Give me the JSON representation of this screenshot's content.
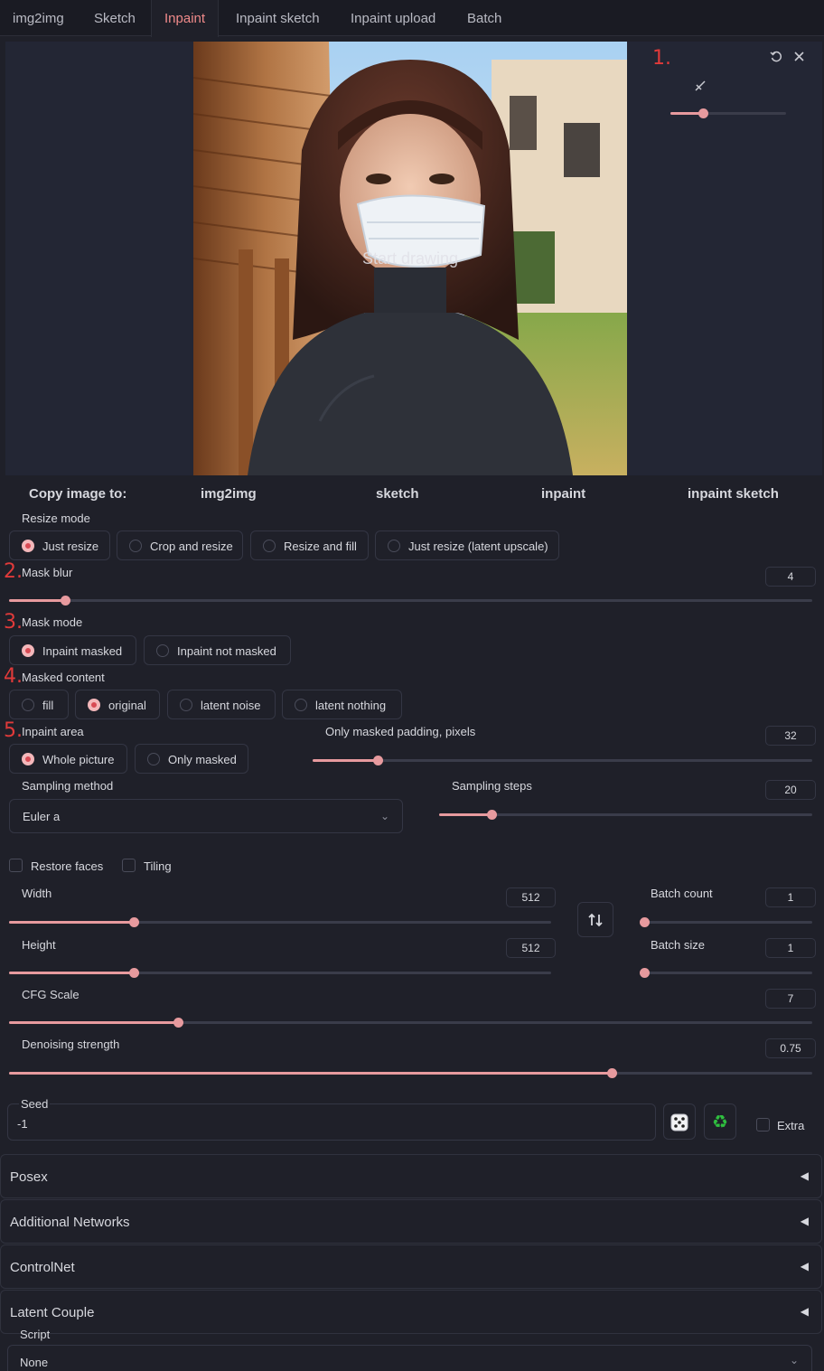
{
  "tabs": [
    {
      "label": "img2img"
    },
    {
      "label": "Sketch"
    },
    {
      "label": "Inpaint"
    },
    {
      "label": "Inpaint sketch"
    },
    {
      "label": "Inpaint upload"
    },
    {
      "label": "Batch"
    }
  ],
  "active_tab": "Inpaint",
  "canvas": {
    "overlay_text": "Start drawing",
    "brush_size_fraction": 0.28
  },
  "annotations": [
    "1.",
    "2.",
    "3.",
    "4.",
    "5."
  ],
  "copy_image": {
    "label": "Copy image to:",
    "targets": [
      "img2img",
      "sketch",
      "inpaint",
      "inpaint sketch"
    ]
  },
  "resize_mode": {
    "label": "Resize mode",
    "options": [
      "Just resize",
      "Crop and resize",
      "Resize and fill",
      "Just resize (latent upscale)"
    ],
    "selected": "Just resize"
  },
  "mask_blur": {
    "label": "Mask blur",
    "value": "4",
    "fraction": 0.07
  },
  "mask_mode": {
    "label": "Mask mode",
    "options": [
      "Inpaint masked",
      "Inpaint not masked"
    ],
    "selected": "Inpaint masked"
  },
  "masked_content": {
    "label": "Masked content",
    "options": [
      "fill",
      "original",
      "latent noise",
      "latent nothing"
    ],
    "selected": "original"
  },
  "inpaint_area": {
    "label": "Inpaint area",
    "options": [
      "Whole picture",
      "Only masked"
    ],
    "selected": "Whole picture"
  },
  "padding": {
    "label": "Only masked padding, pixels",
    "value": "32",
    "fraction": 0.13
  },
  "sampling_method": {
    "label": "Sampling method",
    "value": "Euler a"
  },
  "sampling_steps": {
    "label": "Sampling steps",
    "value": "20",
    "fraction": 0.14
  },
  "restore_faces": {
    "label": "Restore faces",
    "checked": false
  },
  "tiling": {
    "label": "Tiling",
    "checked": false
  },
  "width": {
    "label": "Width",
    "value": "512",
    "fraction": 0.23
  },
  "height": {
    "label": "Height",
    "value": "512",
    "fraction": 0.23
  },
  "batch_count": {
    "label": "Batch count",
    "value": "1",
    "fraction": 0.0
  },
  "batch_size": {
    "label": "Batch size",
    "value": "1",
    "fraction": 0.0
  },
  "cfg_scale": {
    "label": "CFG Scale",
    "value": "7",
    "fraction": 0.21
  },
  "denoising": {
    "label": "Denoising strength",
    "value": "0.75",
    "fraction": 0.75
  },
  "seed": {
    "label": "Seed",
    "value": "-1"
  },
  "extra": {
    "label": "Extra",
    "checked": false
  },
  "accordions": [
    "Posex",
    "Additional Networks",
    "ControlNet",
    "Latent Couple"
  ],
  "script": {
    "label": "Script",
    "value": "None"
  },
  "colors": {
    "accent": "#e79a9e",
    "active_tab": "#f08a8a",
    "background": "#1f2029",
    "annotation_red": "#e03a3a"
  },
  "icons": {
    "undo": "undo-icon",
    "close": "close-icon",
    "brush": "brush-icon",
    "swap": "swap-dimensions-icon",
    "dice": "dice-icon",
    "recycle": "recycle-icon",
    "collapse": "triangle-left-icon",
    "chevron": "chevron-down-icon"
  }
}
